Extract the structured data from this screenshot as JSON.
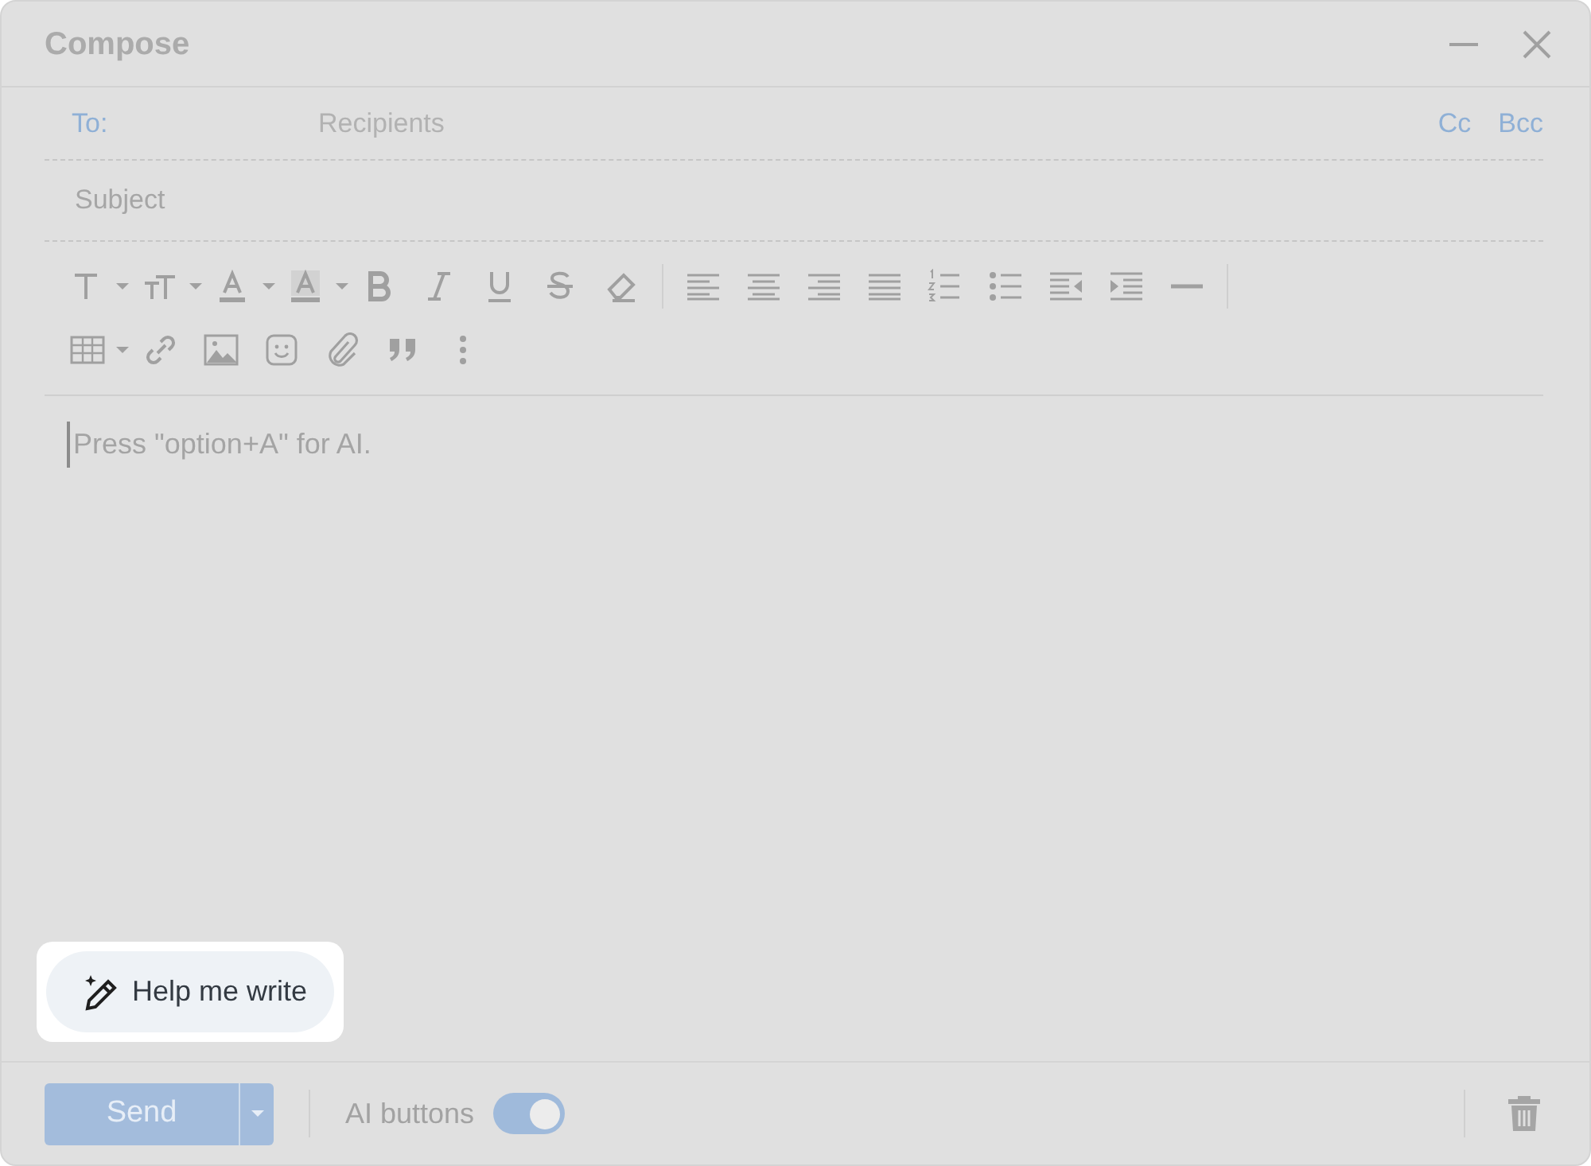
{
  "window": {
    "title": "Compose"
  },
  "to": {
    "label": "To:",
    "placeholder": "Recipients"
  },
  "recipient_links": [
    {
      "label": "Cc"
    },
    {
      "label": "Bcc"
    }
  ],
  "subject": {
    "placeholder": "Subject"
  },
  "body": {
    "placeholder": "Press \"option+A\" for AI."
  },
  "help_button": {
    "label": "Help me write"
  },
  "send": {
    "label": "Send"
  },
  "ai_toggle": {
    "label": "AI buttons",
    "on": true
  }
}
